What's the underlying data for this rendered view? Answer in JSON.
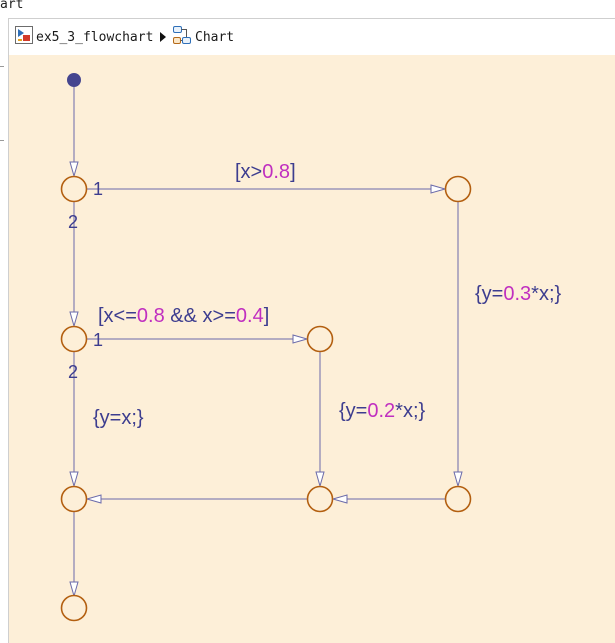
{
  "window": {
    "tab_text": "art"
  },
  "breadcrumb": {
    "model_label": "ex5_3_flowchart",
    "chart_label": "Chart"
  },
  "colors": {
    "canvas_bg": "#fdefd8",
    "junction_stroke": "#b35f10",
    "transition_stroke": "#6a6aaa",
    "label_text": "#3d3d8f",
    "number_literal": "#c02fc0"
  },
  "transitions": {
    "t1": {
      "pre": "[x>",
      "num": "0.8",
      "post": "]"
    },
    "t2": {
      "pre": "[x<=",
      "num": "0.8",
      "mid": " && x>=",
      "num2": "0.4",
      "post": "]"
    },
    "a3": {
      "pre": "{y=",
      "num": "0.3",
      "post": "*x;}"
    },
    "a2": {
      "pre": "{y=",
      "num": "0.2",
      "post": "*x;}"
    },
    "a1": {
      "text": "{y=x;}"
    }
  },
  "execution_order": {
    "j1_first": "1",
    "j1_second": "2",
    "j2_first": "1",
    "j2_second": "2"
  }
}
